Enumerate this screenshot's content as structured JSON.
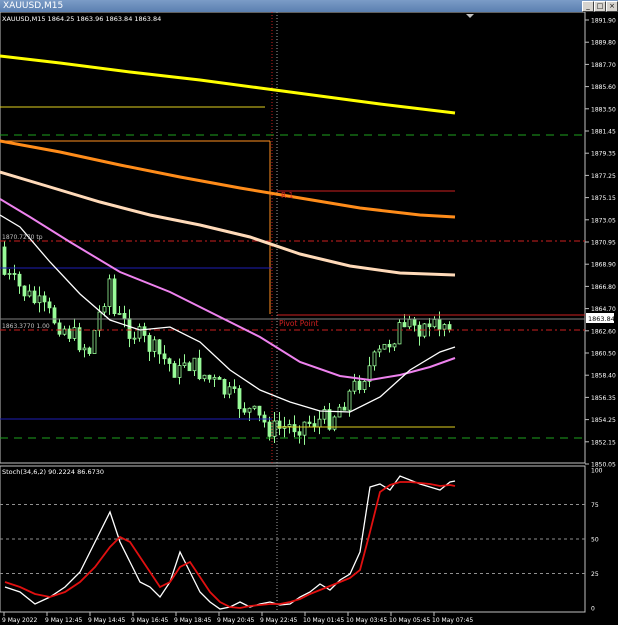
{
  "window": {
    "title": "XAUUSD,M15",
    "buttons": [
      "_",
      "□",
      "×"
    ]
  },
  "main_chart": {
    "label": "XAUUSD,M15  1864.25 1863.96 1863.84 1863.84",
    "current_price": "1863.84",
    "price_ticks": [
      "1891.90",
      "1889.80",
      "1887.70",
      "1885.60",
      "1883.50",
      "1881.45",
      "1879.35",
      "1877.25",
      "1875.15",
      "1873.05",
      "1870.95",
      "1868.90",
      "1866.80",
      "1864.70",
      "1862.60",
      "1860.50",
      "1858.40",
      "1856.35",
      "1854.25",
      "1852.15",
      "1850.05"
    ],
    "object_labels": {
      "r1": "R 1",
      "pivot": "Pivot Point",
      "tp": "1870.7270 tp",
      "sl": "1863.3770 1.00"
    },
    "colors": {
      "bullish_candle": "#98fb98",
      "ema_yellow": "#ffff00",
      "ema_orange": "#ff8c1a",
      "ema_peach": "#ffdab9",
      "ema_violet": "#ee82ee",
      "ema_white": "#ffffff",
      "pivot_red": "#cc2020",
      "support_blue": "#1e1eb4",
      "line_green": "#1ea21e"
    }
  },
  "stochastic": {
    "label": "Stoch(34,6,2) 90.2224 86.6730",
    "ticks": [
      "100",
      "75",
      "50",
      "25",
      "0"
    ]
  },
  "time_axis": [
    "9 May 2022",
    "9 May 12:45",
    "9 May 14:45",
    "9 May 16:45",
    "9 May 18:45",
    "9 May 20:45",
    "9 May 22:45",
    "10 May 01:45",
    "10 May 03:45",
    "10 May 05:45",
    "10 May 07:45"
  ]
}
